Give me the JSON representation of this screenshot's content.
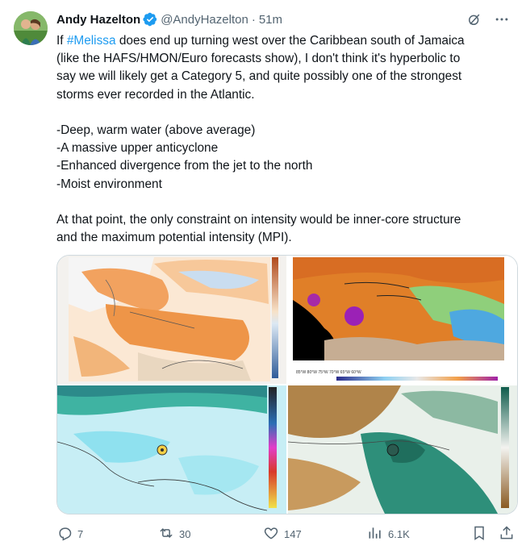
{
  "author": {
    "name": "Andy Hazelton",
    "handle": "@AndyHazelton",
    "separator": "·",
    "time": "51m"
  },
  "tweet": {
    "text_line1_prefix": "If ",
    "hashtag": "#Melissa",
    "text_rest": " does end up turning west over the Caribbean south of Jamaica\n(like the HAFS/HMON/Euro forecasts show), I don't think it's hyperbolic to\nsay we will likely get a Category 5, and quite possibly one of the strongest\nstorms ever recorded in the Atlantic.\n\n-Deep, warm water (above average)\n-A massive upper anticyclone\n-Enhanced divergence from the jet to the north\n-Moist environment\n\nAt that point, the only constraint on intensity would be inner-core structure\nand the maximum potential intensity (MPI)."
  },
  "metrics": {
    "replies": "7",
    "reposts": "30",
    "likes": "147",
    "views": "6.1K"
  },
  "colors": {
    "accent": "#1d9bf0",
    "muted": "#536471",
    "text": "#0f1419",
    "border": "#cfd9de"
  },
  "icons": {
    "verified": "verified-badge-icon",
    "grok": "grok-icon",
    "more": "more-icon",
    "reply": "reply-icon",
    "repost": "repost-icon",
    "like": "like-icon",
    "views": "views-icon",
    "bookmark": "bookmark-icon",
    "share": "share-icon"
  }
}
